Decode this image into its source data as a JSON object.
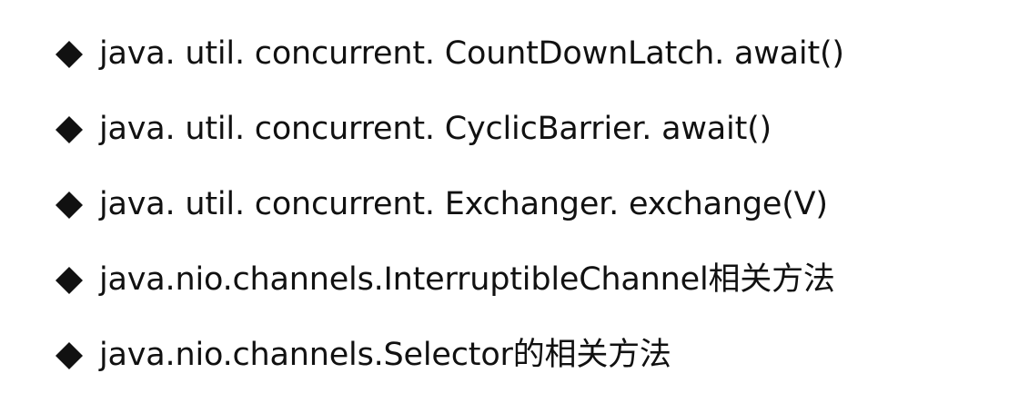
{
  "bullets": [
    {
      "marker_icon": "black-diamond-icon",
      "text": "java. util. concurrent. CountDownLatch. await()"
    },
    {
      "marker_icon": "black-diamond-icon",
      "text": "java. util. concurrent. CyclicBarrier. await()"
    },
    {
      "marker_icon": "black-diamond-icon",
      "text": "java. util. concurrent. Exchanger. exchange(V)"
    },
    {
      "marker_icon": "black-diamond-icon",
      "text": "java.nio.channels.InterruptibleChannel相关方法"
    },
    {
      "marker_icon": "black-diamond-icon",
      "text": "java.nio.channels.Selector的相关方法"
    }
  ],
  "colors": {
    "background": "#ffffff",
    "text": "#111111"
  }
}
